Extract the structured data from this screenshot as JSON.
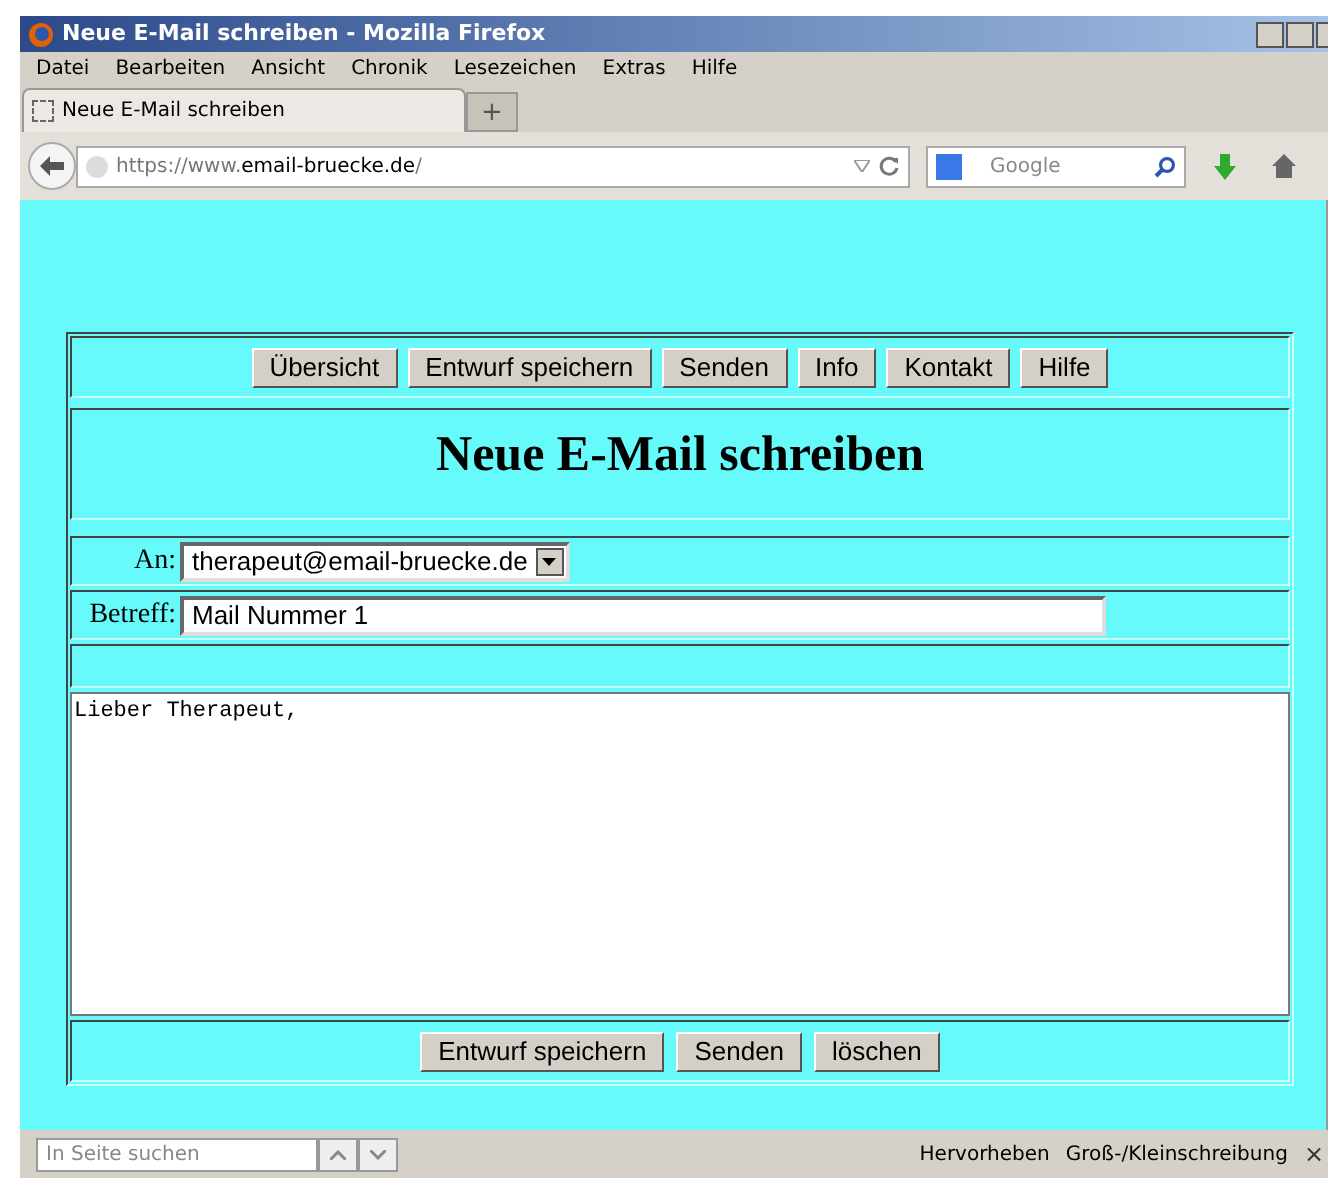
{
  "window": {
    "title": "Neue E-Mail schreiben - Mozilla Firefox"
  },
  "menu": [
    "Datei",
    "Bearbeiten",
    "Ansicht",
    "Chronik",
    "Lesezeichen",
    "Extras",
    "Hilfe"
  ],
  "tabs": [
    {
      "label": "Neue E-Mail schreiben",
      "selected": true
    }
  ],
  "new_tab": "+",
  "address_bar": {
    "prefix": "https://www.",
    "domain": "email-bruecke.de",
    "suffix": "/"
  },
  "search_bar": {
    "placeholder": "Google"
  },
  "page": {
    "nav_buttons": [
      "Übersicht",
      "Entwurf speichern",
      "Senden",
      "Info",
      "Kontakt",
      "Hilfe"
    ],
    "heading": "Neue E-Mail schreiben",
    "to": {
      "label": "An:",
      "value": "therapeut@email-bruecke.de"
    },
    "subject": {
      "label": "Betreff:",
      "value": "Mail Nummer 1"
    },
    "body": "Lieber Therapeut,",
    "bottom_buttons": [
      "Entwurf speichern",
      "Senden",
      "löschen"
    ]
  },
  "find_bar": {
    "placeholder": "In Seite suchen",
    "highlight": "Hervorheben",
    "match_case": "Groß-/Kleinschreibung",
    "close": "×"
  }
}
